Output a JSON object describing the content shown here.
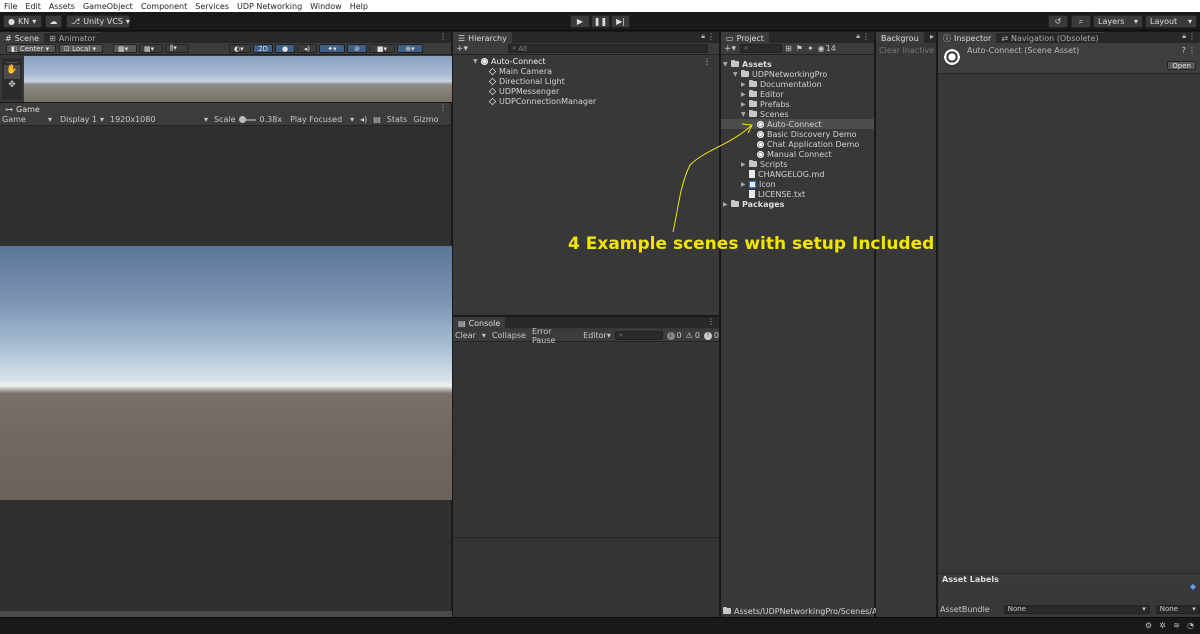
{
  "menu": [
    "File",
    "Edit",
    "Assets",
    "GameObject",
    "Component",
    "Services",
    "UDP Networking",
    "Window",
    "Help"
  ],
  "toolbar": {
    "account": "KN",
    "vcs": "Unity VCS",
    "layers": "Layers",
    "layout": "Layout"
  },
  "scene": {
    "tab_scene": "Scene",
    "tab_animator": "Animator",
    "pivot": "Center",
    "space": "Local",
    "mode_2d": "2D"
  },
  "game": {
    "tab": "Game",
    "view": "Game",
    "display": "Display 1",
    "resolution": "1920x1080",
    "scale_label": "Scale",
    "scale_value": "0.38x",
    "play_mode": "Play Focused",
    "stats": "Stats",
    "gizmos": "Gizmo"
  },
  "hierarchy": {
    "tab": "Hierarchy",
    "search_placeholder": "All",
    "scene": "Auto-Connect",
    "items": [
      "Main Camera",
      "Directional Light",
      "UDPMessenger",
      "UDPConnectionManager"
    ]
  },
  "console": {
    "tab": "Console",
    "clear": "Clear",
    "collapse": "Collapse",
    "error_pause": "Error Pause",
    "editor": "Editor",
    "info_count": "0",
    "warn_count": "0",
    "error_count": "0"
  },
  "project": {
    "tab": "Project",
    "hidden_count": "14",
    "assets": "Assets",
    "root": "UDPNetworkingPro",
    "folders": [
      "Documentation",
      "Editor",
      "Prefabs",
      "Scenes"
    ],
    "scenes": [
      "Auto-Connect",
      "Basic Discovery Demo",
      "Chat Application Demo",
      "Manual Connect"
    ],
    "scripts": "Scripts",
    "changelog": "CHANGELOG.md",
    "icon": "Icon",
    "license": "LICENSE.txt",
    "packages": "Packages",
    "path": "Assets/UDPNetworkingPro/Scenes/Aut"
  },
  "background": {
    "tab": "Backgrou",
    "clear_inactive": "Clear Inactive"
  },
  "inspector": {
    "tab": "Inspector",
    "tab_nav": "Navigation (Obsolete)",
    "asset_title": "Auto-Connect (Scene Asset)",
    "open": "Open",
    "asset_labels": "Asset Labels",
    "asset_bundle": "AssetBundle",
    "bundle_value": "None",
    "variant_value": "None"
  },
  "annotation": {
    "text": "4 Example scenes with setup Included",
    "color": "#f2e600"
  }
}
